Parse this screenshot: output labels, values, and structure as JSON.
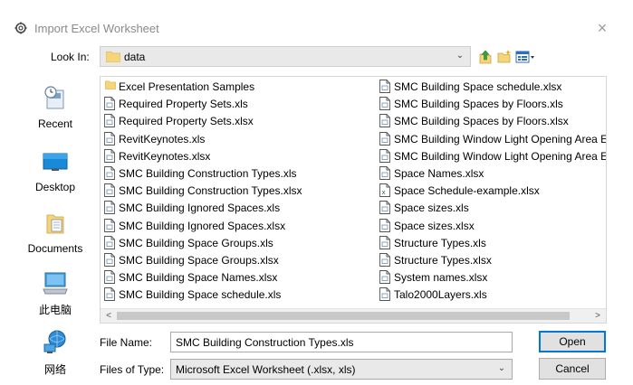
{
  "window": {
    "title": "Import Excel Worksheet",
    "close_glyph": "×",
    "icon": "gear-icon"
  },
  "lookin": {
    "label": "Look In:",
    "value": "data",
    "arrow": "⌄"
  },
  "toolbar": {
    "up_icon": "up-folder-icon",
    "new_folder_icon": "new-folder-icon",
    "view_icon": "view-menu-icon"
  },
  "places": [
    {
      "label": "Recent",
      "icon": "recent-icon"
    },
    {
      "label": "Desktop",
      "icon": "desktop-icon"
    },
    {
      "label": "Documents",
      "icon": "documents-icon"
    },
    {
      "label": "此电脑",
      "icon": "computer-icon"
    },
    {
      "label": "网络",
      "icon": "network-icon"
    }
  ],
  "files": {
    "col1": [
      {
        "name": "Excel Presentation Samples",
        "type": "folder"
      },
      {
        "name": "Required Property Sets.xls",
        "type": "file"
      },
      {
        "name": "Required Property Sets.xlsx",
        "type": "file"
      },
      {
        "name": "RevitKeynotes.xls",
        "type": "file"
      },
      {
        "name": "RevitKeynotes.xlsx",
        "type": "file"
      },
      {
        "name": "SMC Building Construction Types.xls",
        "type": "file"
      },
      {
        "name": "SMC Building Construction Types.xlsx",
        "type": "file"
      },
      {
        "name": "SMC Building Ignored Spaces.xls",
        "type": "file"
      },
      {
        "name": "SMC Building Ignored Spaces.xlsx",
        "type": "file"
      },
      {
        "name": "SMC Building Space Groups.xls",
        "type": "file"
      },
      {
        "name": "SMC Building Space Groups.xlsx",
        "type": "file"
      },
      {
        "name": "SMC Building Space Names.xlsx",
        "type": "file"
      },
      {
        "name": "SMC Building Space schedule.xls",
        "type": "file"
      }
    ],
    "col2": [
      {
        "name": "SMC Building Space schedule.xlsx",
        "type": "file"
      },
      {
        "name": "SMC Building Spaces by Floors.xls",
        "type": "file"
      },
      {
        "name": "SMC Building Spaces by Floors.xlsx",
        "type": "file"
      },
      {
        "name": "SMC Building Window Light Opening Area Ex",
        "type": "file"
      },
      {
        "name": "SMC Building Window Light Opening Area Exa",
        "type": "file"
      },
      {
        "name": "Space Names.xlsx",
        "type": "file"
      },
      {
        "name": "Space Schedule-example.xlsx",
        "type": "excel"
      },
      {
        "name": "Space sizes.xls",
        "type": "file"
      },
      {
        "name": "Space sizes.xlsx",
        "type": "file"
      },
      {
        "name": "Structure Types.xls",
        "type": "file"
      },
      {
        "name": "Structure Types.xlsx",
        "type": "file"
      },
      {
        "name": "System names.xlsx",
        "type": "file"
      },
      {
        "name": "Talo2000Layers.xls",
        "type": "file"
      }
    ]
  },
  "scroll": {
    "left": "<",
    "right": ">"
  },
  "filename": {
    "label": "File Name:",
    "value": "SMC Building Construction Types.xls"
  },
  "filetype": {
    "label": "Files of Type:",
    "value": "Microsoft Excel Worksheet (.xlsx, xls)",
    "arrow": "⌄"
  },
  "buttons": {
    "open": "Open",
    "cancel": "Cancel"
  },
  "colors": {
    "folder": "#f6d57a",
    "accent": "#0078d7",
    "excel": "#1e7145"
  }
}
